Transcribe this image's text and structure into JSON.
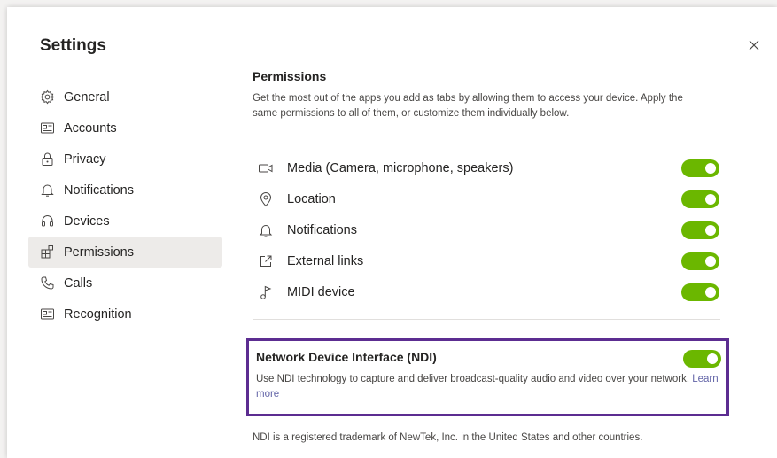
{
  "dialog": {
    "title": "Settings",
    "close_icon": "close-icon"
  },
  "sidebar": {
    "items": [
      {
        "label": "General",
        "icon": "gear-icon",
        "active": false
      },
      {
        "label": "Accounts",
        "icon": "id-card-icon",
        "active": false
      },
      {
        "label": "Privacy",
        "icon": "lock-icon",
        "active": false
      },
      {
        "label": "Notifications",
        "icon": "bell-icon",
        "active": false
      },
      {
        "label": "Devices",
        "icon": "headset-icon",
        "active": false
      },
      {
        "label": "Permissions",
        "icon": "apps-grid-icon",
        "active": true
      },
      {
        "label": "Calls",
        "icon": "phone-icon",
        "active": false
      },
      {
        "label": "Recognition",
        "icon": "id-card-icon",
        "active": false
      }
    ]
  },
  "permissions": {
    "title": "Permissions",
    "description": "Get the most out of the apps you add as tabs by allowing them to access your device. Apply the same permissions to all of them, or customize them individually below.",
    "items": [
      {
        "label": "Media (Camera, microphone, speakers)",
        "icon": "camera-icon",
        "enabled": true
      },
      {
        "label": "Location",
        "icon": "location-pin-icon",
        "enabled": true
      },
      {
        "label": "Notifications",
        "icon": "bell-icon",
        "enabled": true
      },
      {
        "label": "External links",
        "icon": "external-link-icon",
        "enabled": true
      },
      {
        "label": "MIDI device",
        "icon": "music-note-icon",
        "enabled": true
      }
    ]
  },
  "ndi": {
    "title": "Network Device Interface (NDI)",
    "description": "Use NDI technology to capture and deliver broadcast-quality audio and video over your network.",
    "link_text": "Learn more",
    "enabled": true
  },
  "trademark": "NDI is a registered trademark of NewTek, Inc. in the United States and other countries.",
  "colors": {
    "toggle_on": "#6bb700",
    "highlight_border": "#5c2d91",
    "link": "#6264a7",
    "active_nav": "#edebe9"
  }
}
